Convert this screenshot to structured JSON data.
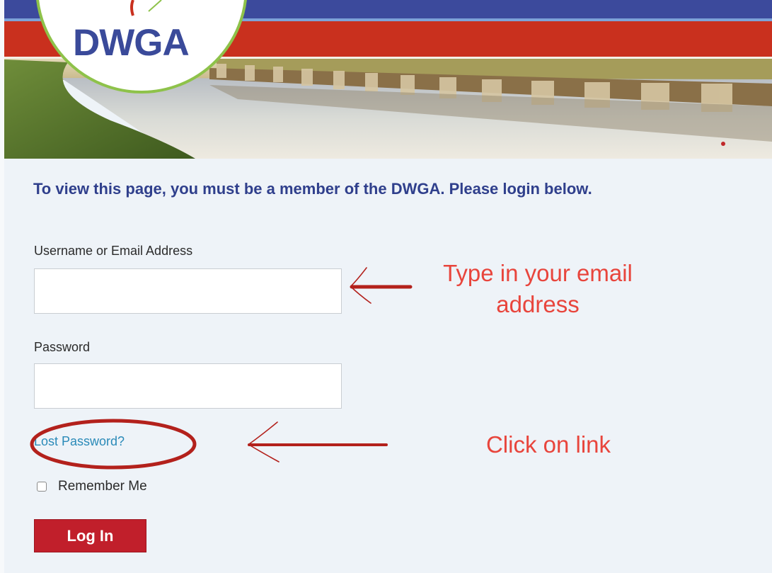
{
  "header": {
    "logo_text": "DWGA",
    "colors": {
      "top_band": "#3c4a9c",
      "red_band": "#c9301e",
      "logo_ring": "#8ec24a",
      "logo_text": "#3a4a9a"
    }
  },
  "notice": {
    "text": "To view this page, you must be a member of the DWGA. Please login below."
  },
  "form": {
    "username_label": "Username or Email Address",
    "username_value": "",
    "password_label": "Password",
    "password_value": "",
    "lost_password_link": "Lost Password?",
    "remember_label": "Remember Me",
    "remember_checked": false,
    "submit_label": "Log In"
  },
  "annotations": {
    "email_hint_line1": "Type in your email",
    "email_hint_line2": "address",
    "link_hint": "Click on link",
    "color": "#e8453c",
    "mark_color": "#b3211c"
  },
  "icons": {
    "checkbox": "checkbox-icon",
    "arrows": "arrow-left-icon",
    "circle": "ellipse-highlight-icon"
  }
}
